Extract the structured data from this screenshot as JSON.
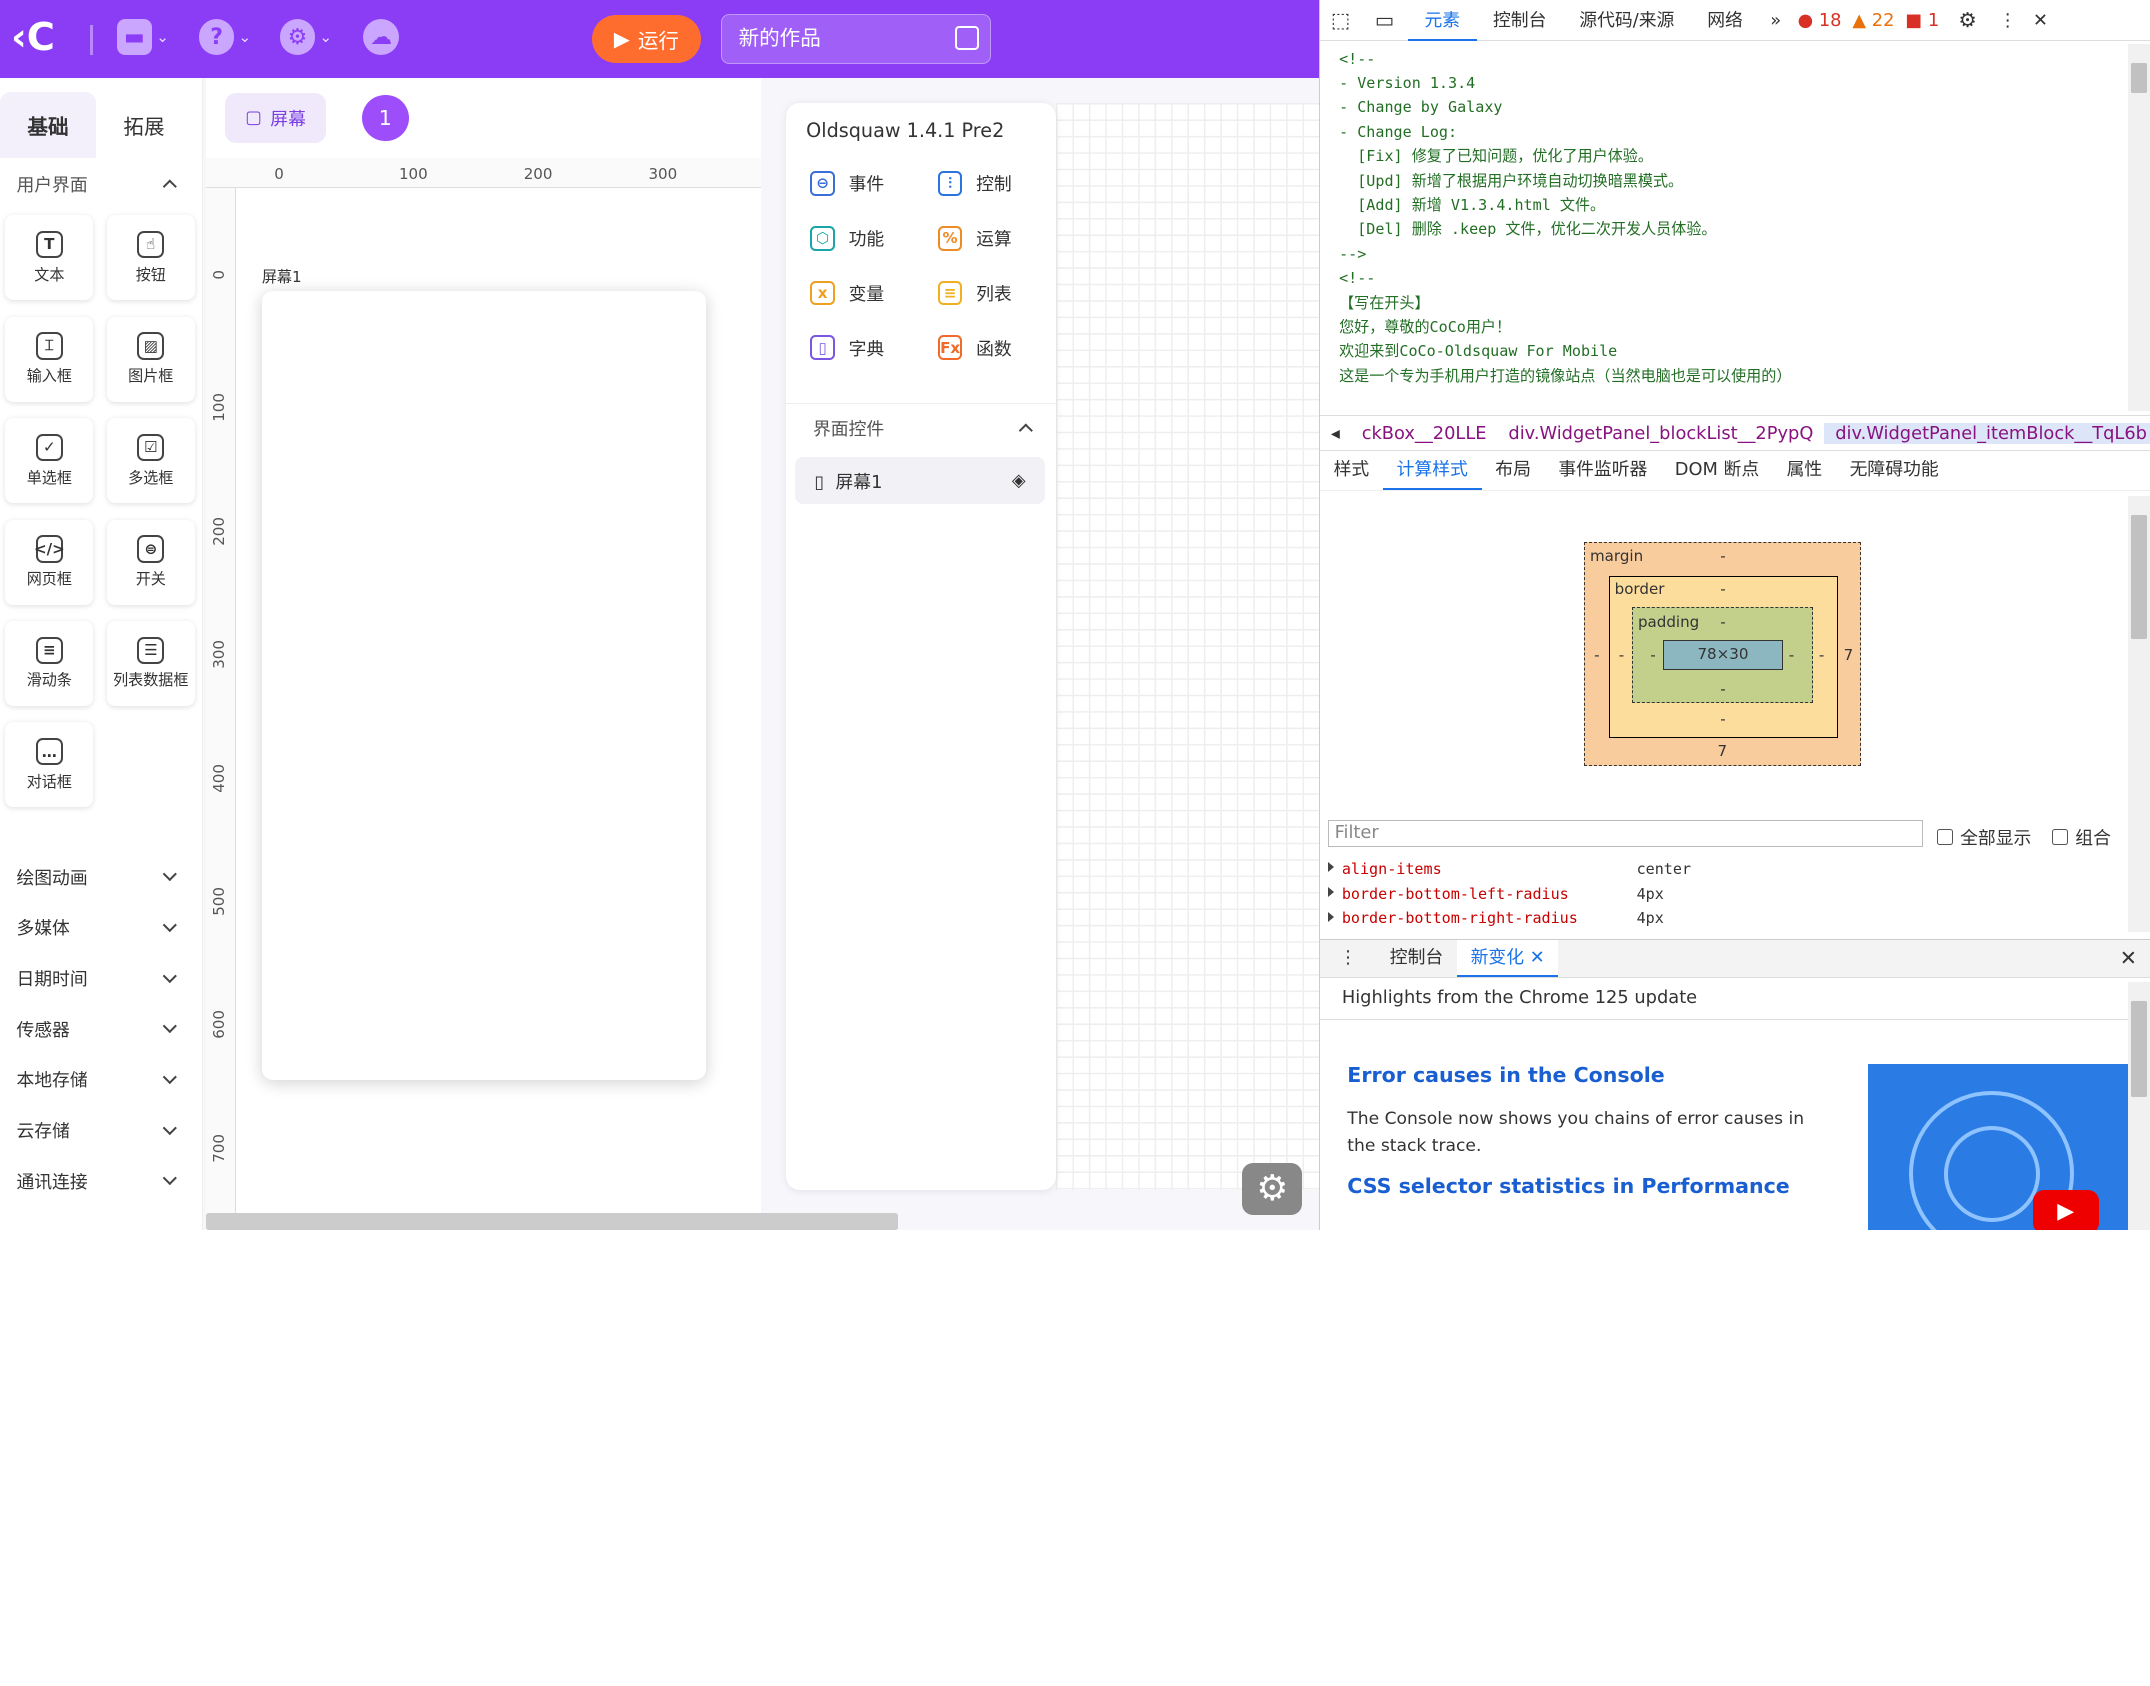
{
  "topbar": {
    "run_label": "运行",
    "project_title": "新的作品"
  },
  "palette": {
    "tabs": [
      "基础",
      "拓展"
    ],
    "section": "用户界面",
    "items": [
      {
        "label": "文本",
        "icon": "text-icon"
      },
      {
        "label": "按钮",
        "icon": "button-icon"
      },
      {
        "label": "输入框",
        "icon": "input-icon"
      },
      {
        "label": "图片框",
        "icon": "image-icon"
      },
      {
        "label": "单选框",
        "icon": "radio-icon"
      },
      {
        "label": "多选框",
        "icon": "checkbox-icon"
      },
      {
        "label": "网页框",
        "icon": "webview-icon"
      },
      {
        "label": "开关",
        "icon": "switch-icon"
      },
      {
        "label": "滑动条",
        "icon": "slider-icon"
      },
      {
        "label": "列表数据框",
        "icon": "list-icon"
      },
      {
        "label": "对话框",
        "icon": "dialog-icon"
      }
    ],
    "groups": [
      "绘图动画",
      "多媒体",
      "日期时间",
      "传感器",
      "本地存储",
      "云存储",
      "通讯连接"
    ]
  },
  "canvas": {
    "screen_btn": "屏幕",
    "page_num": "1",
    "screen_label": "屏幕1",
    "hticks": [
      "0",
      "100",
      "200",
      "300"
    ],
    "vticks": [
      "0",
      "100",
      "200",
      "300",
      "400",
      "500",
      "600",
      "700"
    ]
  },
  "widgets": {
    "version": "Oldsquaw 1.4.1 Pre2",
    "items": [
      {
        "label": "事件",
        "color": "#3b6fd8",
        "glyph": "⊖"
      },
      {
        "label": "控制",
        "color": "#2a74e0",
        "glyph": "⫶"
      },
      {
        "label": "功能",
        "color": "#1aa6a6",
        "glyph": "⬡"
      },
      {
        "label": "运算",
        "color": "#f08a24",
        "glyph": "%"
      },
      {
        "label": "变量",
        "color": "#f0a020",
        "glyph": "x"
      },
      {
        "label": "列表",
        "color": "#f0b020",
        "glyph": "≡"
      },
      {
        "label": "字典",
        "color": "#7b56e0",
        "glyph": "▯"
      },
      {
        "label": "函数",
        "color": "#f06a2a",
        "glyph": "Fx"
      }
    ],
    "ui_section": "界面控件",
    "screen_item": "屏幕1"
  },
  "devtools": {
    "tabs": [
      "元素",
      "控制台",
      "源代码/来源",
      "网络"
    ],
    "errors": "18",
    "warnings": "22",
    "issues": "1",
    "source_lines": [
      "<!--",
      "- Version 1.3.4",
      "- Change by Galaxy",
      "- Change Log:",
      "  [Fix] 修复了已知问题，优化了用户体验。",
      "  [Upd] 新增了根据用户环境自动切换暗黑模式。",
      "  [Add] 新增 V1.3.4.html 文件。",
      "  [Del] 删除 .keep 文件，优化二次开发人员体验。",
      "-->",
      "<!--",
      "【写在开头】",
      "您好，尊敬的CoCo用户！",
      "欢迎来到CoCo-Oldsquaw For Mobile",
      "这是一个专为手机用户打造的镜像站点（当然电脑也是可以使用的）"
    ],
    "breadcrumb": [
      "ckBox__20LLE",
      "div.WidgetPanel_blockList__2PypQ",
      "div.WidgetPanel_itemBlock__TqL6b"
    ],
    "style_tabs": [
      "样式",
      "计算样式",
      "布局",
      "事件监听器",
      "DOM 断点",
      "属性",
      "无障碍功能"
    ],
    "boxmodel": {
      "margin": "margin",
      "border": "border",
      "padding": "padding",
      "content": "78×30",
      "dash": "-",
      "seven": "7"
    },
    "filter_placeholder": "Filter",
    "show_all": "全部显示",
    "group": "组合",
    "props": [
      {
        "k": "align-items",
        "v": "center"
      },
      {
        "k": "border-bottom-left-radius",
        "v": "4px"
      },
      {
        "k": "border-bottom-right-radius",
        "v": "4px"
      }
    ],
    "drawer_tabs": [
      "控制台",
      "新变化"
    ],
    "highlights": "Highlights from the Chrome 125 update",
    "article": {
      "h1": "Error causes in the Console",
      "p1": "The Console now shows you chains of error causes in the stack trace.",
      "h2": "CSS selector statistics in Performance"
    }
  }
}
